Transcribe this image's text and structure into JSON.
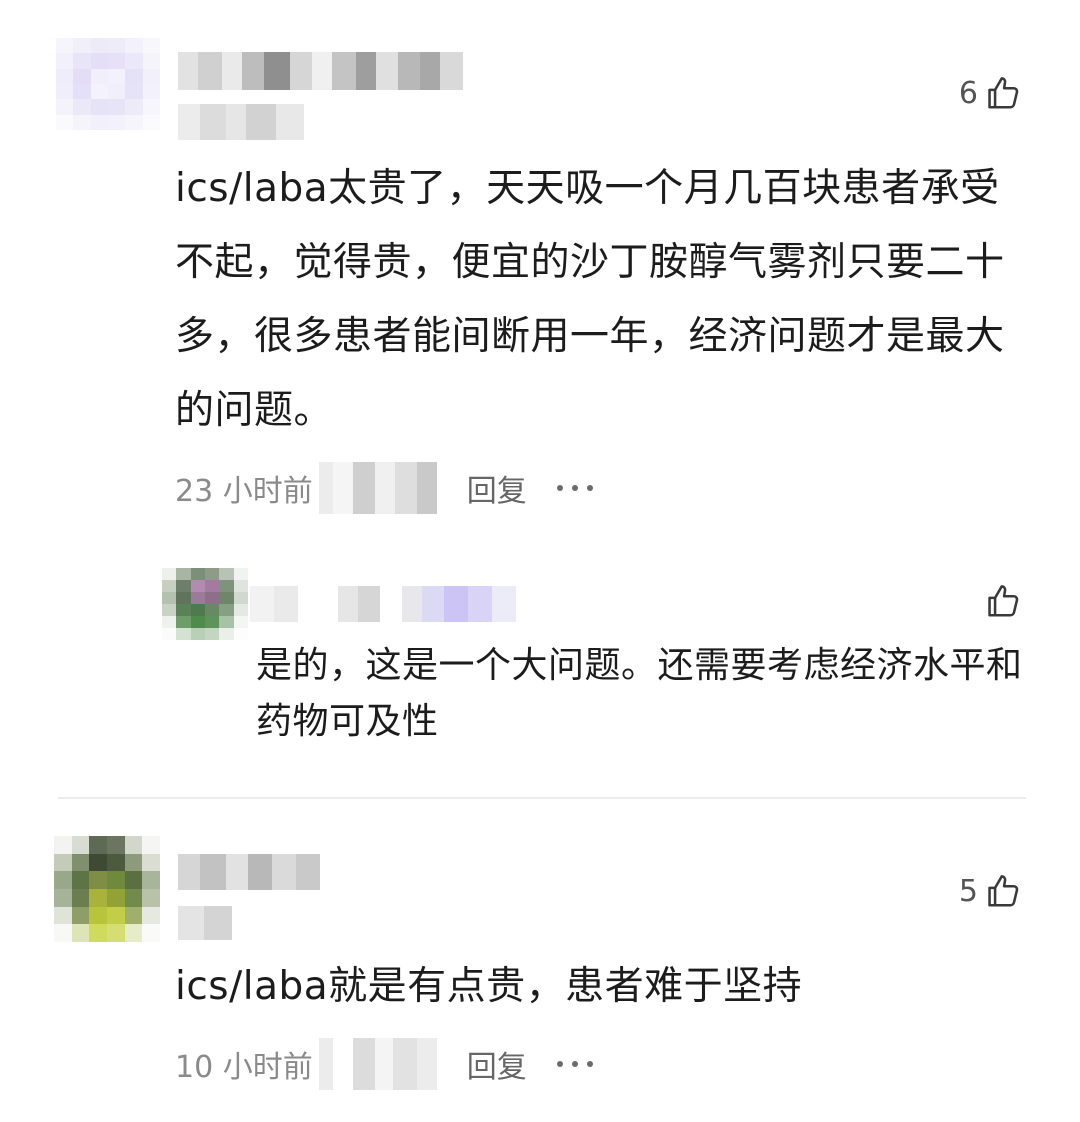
{
  "comments": [
    {
      "likes": "6",
      "text": "ics/laba太贵了，天天吸一个月几百块患者承受不起，觉得贵，便宜的沙丁胺醇气雾剂只要二十多，很多患者能间断用一年，经济问题才是最大的问题。",
      "time": "23 小时前",
      "reply_label": "回复",
      "replies": [
        {
          "likes": "",
          "text": "是的，这是一个大问题。还需要考虑经济水平和药物可及性"
        }
      ]
    },
    {
      "likes": "5",
      "text": "ics/laba就是有点贵，患者难于坚持",
      "time": "10 小时前",
      "reply_label": "回复"
    }
  ],
  "icons": {
    "like": "thumbs-up-icon",
    "more": "more-dots-icon"
  },
  "colors": {
    "text": "#1c1c1c",
    "meta": "#8a8a8a",
    "divider": "#ececec"
  }
}
